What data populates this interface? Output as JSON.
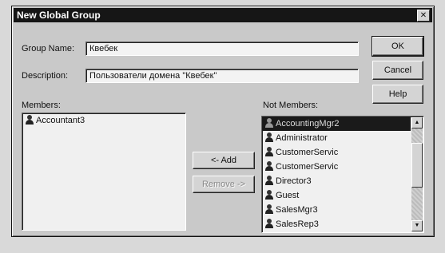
{
  "window": {
    "title": "New Global Group",
    "close_glyph": "✕"
  },
  "group_name": {
    "label": "Group Name:",
    "value": "Квебек"
  },
  "description": {
    "label": "Description:",
    "value": "Пользователи домена \"Квебек\""
  },
  "members": {
    "label": "Members:",
    "items": [
      "Accountant3"
    ]
  },
  "not_members": {
    "label": "Not Members:",
    "selected_index": 0,
    "items": [
      "AccountingMgr2",
      "Administrator",
      "CustomerServic",
      "CustomerServic",
      "Director3",
      "Guest",
      "SalesMgr3",
      "SalesRep3"
    ]
  },
  "buttons": {
    "ok": "OK",
    "cancel": "Cancel",
    "help": "Help",
    "add": "<- Add",
    "remove": "Remove ->"
  },
  "scroll": {
    "position": 0.3
  }
}
